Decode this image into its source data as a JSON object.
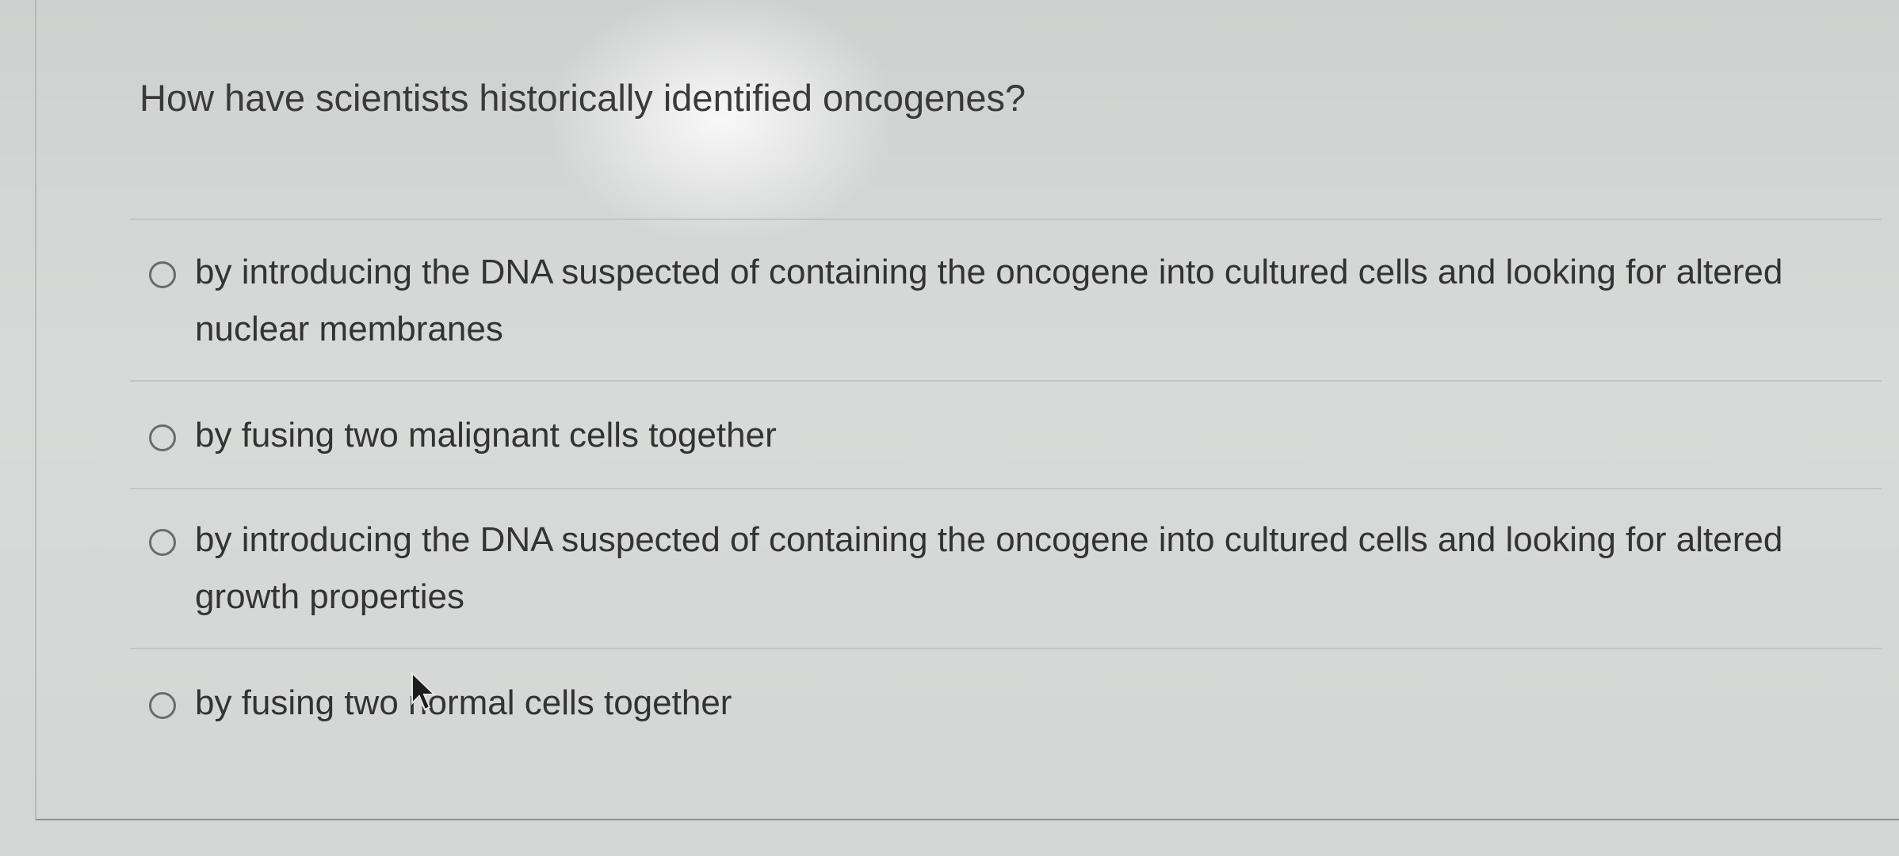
{
  "question": {
    "text": "How have scientists historically identified oncogenes?"
  },
  "options": [
    {
      "label": "by introducing the DNA suspected of containing the oncogene into cultured cells and looking for altered nuclear membranes",
      "selected": false
    },
    {
      "label": "by fusing two malignant cells together",
      "selected": false
    },
    {
      "label": "by introducing the DNA suspected of containing the oncogene into cultured cells and looking for altered growth properties",
      "selected": false
    },
    {
      "label": "by fusing two normal cells together",
      "selected": false
    }
  ],
  "icons": {
    "radio": "radio-button-unselected",
    "cursor": "mouse-pointer-arrow"
  }
}
